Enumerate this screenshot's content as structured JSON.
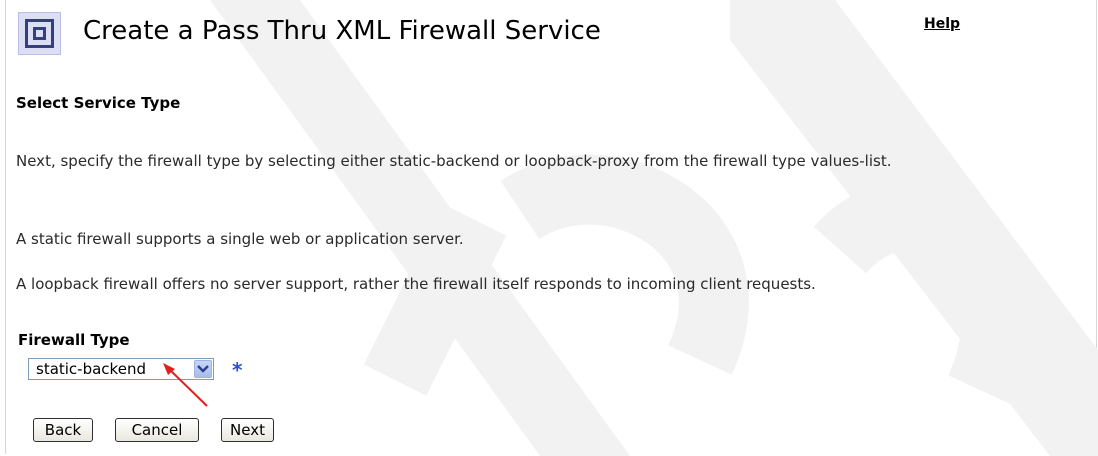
{
  "header": {
    "title": "Create a Pass Thru XML Firewall Service",
    "help_link": "Help",
    "logo_icon": "firewall-service-logo-icon"
  },
  "section_heading": "Select Service Type",
  "paragraphs": [
    "Next, specify the firewall type by selecting either static-backend or loopback-proxy from the firewall type values-list.",
    "A static firewall supports a single web or application server.",
    "A loopback firewall offers no server support, rather the firewall itself responds to incoming client requests."
  ],
  "firewall_type": {
    "label": "Firewall Type",
    "selected_value": "static-backend",
    "required_marker": "*",
    "required_color": "#2850d8"
  },
  "buttons": {
    "back": "Back",
    "cancel": "Cancel",
    "next": "Next"
  },
  "annotation": {
    "arrow_color": "#e02020"
  }
}
